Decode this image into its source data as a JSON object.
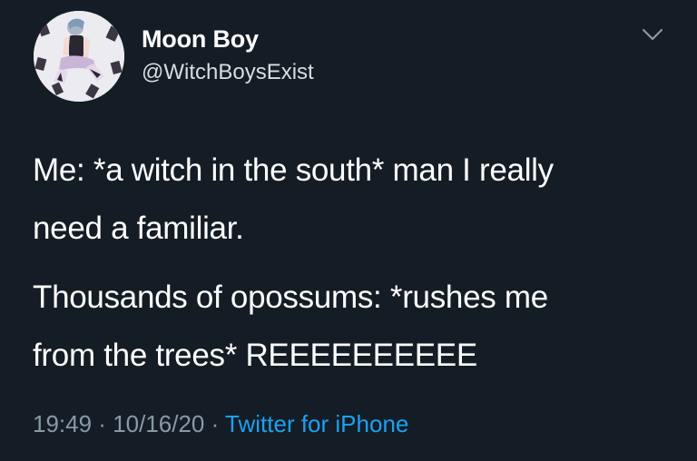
{
  "tweet": {
    "display_name": "Moon Boy",
    "handle": "@WitchBoysExist",
    "paragraphs": [
      "Me: *a witch in the south* man I really\nneed a familiar.",
      "Thousands of opossums: *rushes me\nfrom the trees* REEEEEEEEEE"
    ],
    "time": "19:49",
    "separator1": " · ",
    "date": "10/16/20",
    "separator2": " · ",
    "source": "Twitter for iPhone"
  },
  "icons": {
    "avatar": "profile-avatar-illustration",
    "menu": "chevron-down-icon"
  },
  "colors": {
    "background": "#141d26",
    "text": "#ffffff",
    "secondary": "#8899a6",
    "link": "#1da1f2"
  }
}
